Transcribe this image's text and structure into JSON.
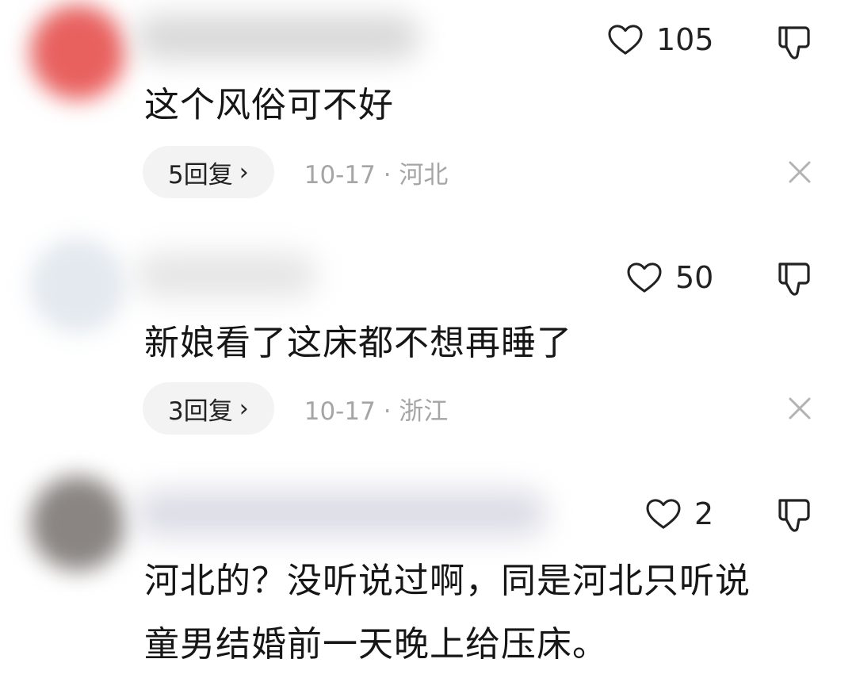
{
  "comments": [
    {
      "likes": "105",
      "text": "这个风俗可不好",
      "reply_label": "5回复",
      "date": "10-17",
      "separator": "·",
      "location": "河北",
      "avatar_color": "#e8615f"
    },
    {
      "likes": "50",
      "text": "新娘看了这床都不想再睡了",
      "reply_label": "3回复",
      "date": "10-17",
      "separator": "·",
      "location": "浙江",
      "avatar_color": "#e3e9ef"
    },
    {
      "likes": "2",
      "text_line1": "河北的？没听说过啊，同是河北只听说",
      "text_line2": "童男结婚前一天晚上给压床。",
      "avatar_color": "#8a8582"
    }
  ],
  "icons": {
    "like": "heart-outline-icon",
    "dislike": "thumbs-down-outline-icon",
    "reply_arrow": "chevron-right-icon",
    "close": "close-x-icon"
  }
}
